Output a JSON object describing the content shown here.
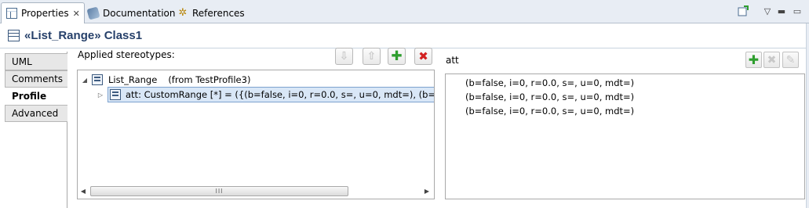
{
  "tabs": [
    {
      "label": "Properties",
      "icon": "properties-icon",
      "active": true
    },
    {
      "label": "Documentation",
      "icon": "documentation-icon",
      "active": false
    },
    {
      "label": "References",
      "icon": "references-icon",
      "active": false
    }
  ],
  "header": {
    "title": "«List_Range» Class1"
  },
  "sections": [
    "UML",
    "Comments",
    "Profile",
    "Advanced"
  ],
  "selected_section": "Profile",
  "stereotypes": {
    "label": "Applied stereotypes:",
    "tree": [
      {
        "name": "List_Range",
        "from": "(from TestProfile3)",
        "expanded": true
      },
      {
        "name": "att: CustomRange [*] = ({(b=false, i=0, r=0.0, s=, u=0, mdt=), (b=false, i=0,",
        "selected": true
      }
    ],
    "scroll_thumb": "III"
  },
  "att": {
    "label": "att",
    "values": [
      "(b=false, i=0, r=0.0, s=, u=0, mdt=)",
      "(b=false, i=0, r=0.0, s=, u=0, mdt=)",
      "(b=false, i=0, r=0.0, s=, u=0, mdt=)"
    ]
  },
  "colors": {
    "title": "#26406a",
    "add": "#2e9e2e",
    "delete": "#d22020",
    "selection": "#d9e7f7"
  }
}
